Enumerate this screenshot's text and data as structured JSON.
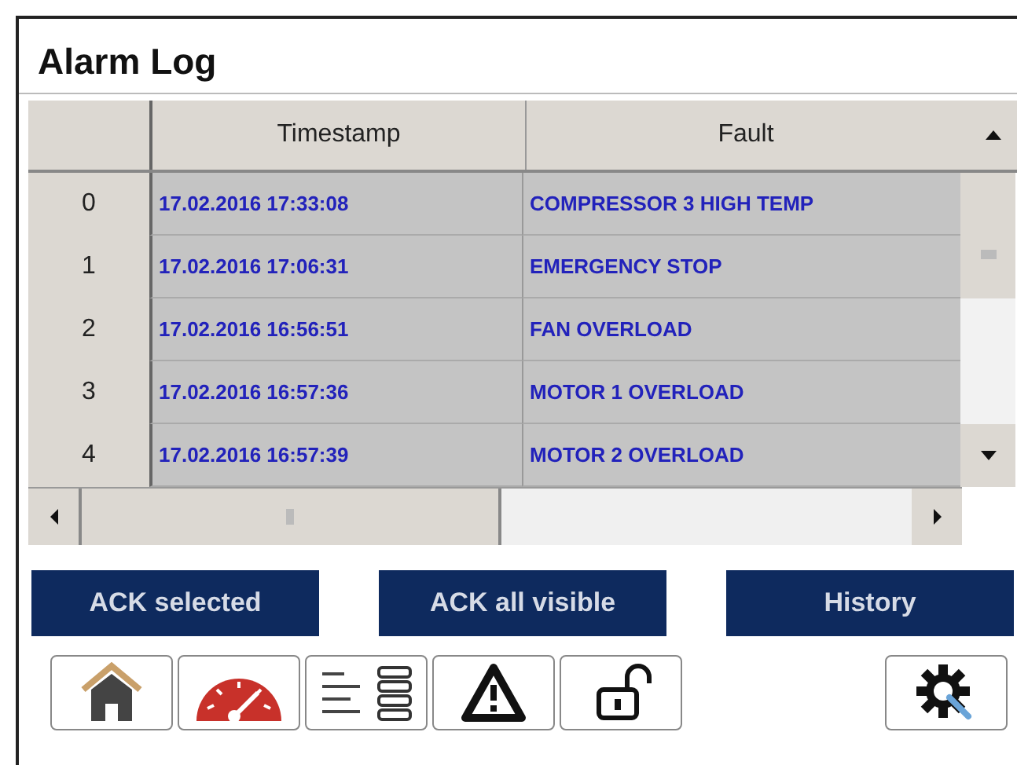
{
  "title": "Alarm Log",
  "table": {
    "columns": [
      "Timestamp",
      "Fault"
    ],
    "rows": [
      {
        "index": "0",
        "timestamp": "17.02.2016 17:33:08",
        "fault": "COMPRESSOR 3 HIGH TEMP"
      },
      {
        "index": "1",
        "timestamp": "17.02.2016 17:06:31",
        "fault": "EMERGENCY STOP"
      },
      {
        "index": "2",
        "timestamp": "17.02.2016 16:56:51",
        "fault": "FAN OVERLOAD"
      },
      {
        "index": "3",
        "timestamp": "17.02.2016 16:57:36",
        "fault": "MOTOR 1 OVERLOAD"
      },
      {
        "index": "4",
        "timestamp": "17.02.2016 16:57:39",
        "fault": "MOTOR 2 OVERLOAD"
      }
    ]
  },
  "buttons": [
    "ACK selected",
    "ACK all visible",
    "History"
  ],
  "toolbar": [
    {
      "kind": "home"
    },
    {
      "kind": "gauge"
    },
    {
      "kind": "list"
    },
    {
      "kind": "warning"
    },
    {
      "kind": "unlock"
    },
    {
      "kind": "spacer"
    },
    {
      "kind": "settings"
    }
  ]
}
